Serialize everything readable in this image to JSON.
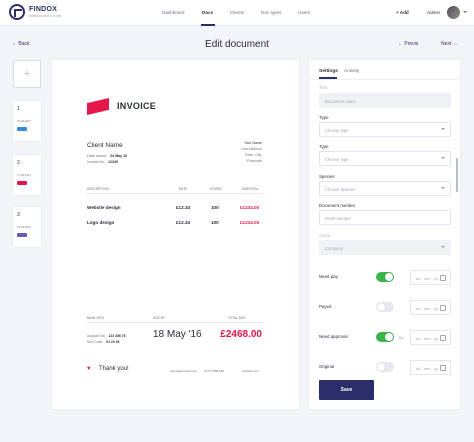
{
  "app": {
    "brand": "FINDOX",
    "brand_sub": "WWW.FINDOX.COM"
  },
  "nav": {
    "items": [
      "Dashboard",
      "Docs",
      "Clients",
      "Doc types",
      "Users"
    ],
    "active": "Docs",
    "add": "+ Add",
    "user": "Admin"
  },
  "header": {
    "back": "Back",
    "title": "Edit document",
    "prev": "Previs",
    "next": "Next"
  },
  "thumbnails": [
    {
      "num": "1",
      "date": "15.03.2017",
      "badge_color": "#3a86e0"
    },
    {
      "num": "2",
      "date": "17.03.2017",
      "badge_color": "#e5174a"
    },
    {
      "num": "3",
      "date": "19.03.2017",
      "badge_color": "#6b5bb8"
    }
  ],
  "invoice": {
    "title": "INVOICE",
    "client_name": "Client Name",
    "date_issued_label": "Date Issued:",
    "date_issued": "04 May 16",
    "invoice_no_label": "Invoice No:",
    "invoice_no": "12345",
    "address": [
      "Your Name",
      "Your Address",
      "Town, City,",
      "Postcode"
    ],
    "columns": [
      "DESCRIPTION",
      "RATE",
      "HOURS",
      "SUBTOTAL"
    ],
    "rows": [
      {
        "desc": "Website design",
        "rate": "£12.34",
        "hours": "100",
        "subtotal": "£1234.00"
      },
      {
        "desc": "Logo design",
        "rate": "£12.34",
        "hours": "100",
        "subtotal": "£1234.00"
      }
    ],
    "footer_columns": [
      "BANK INFO",
      "DUE BY",
      "TOTAL DUE"
    ],
    "account_label": "Account No:",
    "account_no": "123 456 78",
    "sort_label": "Sort Code:",
    "sort_code": "01 23 45",
    "due_by": "18 May '16",
    "total_due": "£2468.00",
    "thanks": "Thank you!",
    "contact": [
      "name@domain.com",
      "07777 888 999",
      "website.com"
    ]
  },
  "panel": {
    "tabs": [
      "Settings",
      "Activity"
    ],
    "fields": [
      {
        "label": "Title",
        "placeholder": "Document name"
      },
      {
        "label": "Type",
        "placeholder": "Choose type"
      },
      {
        "label": "Type",
        "placeholder": "Choose type"
      },
      {
        "label": "Species",
        "placeholder": "Choose Species"
      },
      {
        "label": "Document number",
        "placeholder": "Insert number"
      },
      {
        "label": "Client",
        "placeholder": "Company"
      }
    ],
    "toggles": [
      {
        "label": "Need pay",
        "on": true,
        "date_placeholder": "dd . mm . yy"
      },
      {
        "label": "Payed",
        "on": false,
        "date_placeholder": "dd . mm . yy"
      },
      {
        "label": "Need approval",
        "on": true,
        "by": "By",
        "date_placeholder": "dd . mm . yy"
      },
      {
        "label": "Original",
        "on": false,
        "date_placeholder": "dd . mm . yy"
      }
    ],
    "save": "Save"
  }
}
